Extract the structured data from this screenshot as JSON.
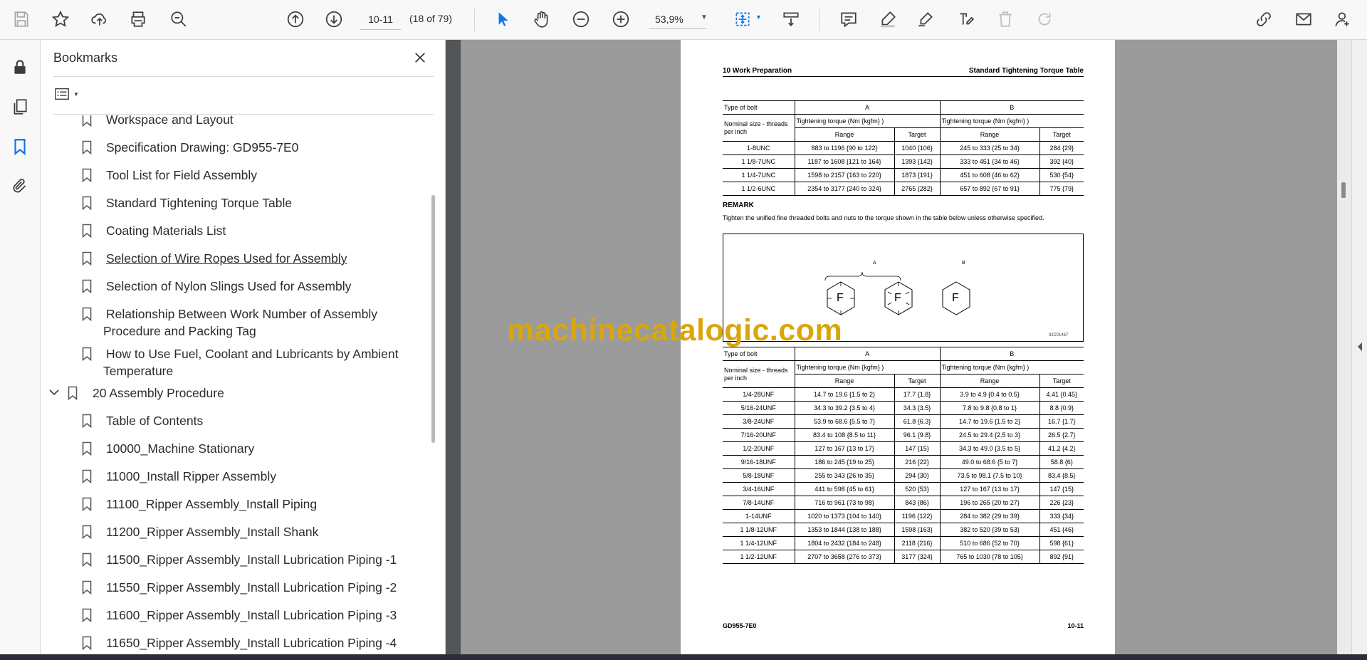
{
  "toolbar": {
    "page_value": "10-11",
    "page_count": "(18 of 79)",
    "zoom": "53,9%"
  },
  "bookmarks": {
    "title": "Bookmarks",
    "items": [
      {
        "label": "Workspace and Layout"
      },
      {
        "label": "Specification Drawing: GD955-7E0"
      },
      {
        "label": "Tool List for Field Assembly"
      },
      {
        "label": "Standard Tightening Torque Table"
      },
      {
        "label": "Coating Materials List"
      },
      {
        "label": "Selection of Wire Ropes Used for Assembly"
      },
      {
        "label": "Selection of Nylon Slings Used for Assembly"
      },
      {
        "label": "Relationship Between Work Number of Assembly Procedure and Packing Tag"
      },
      {
        "label": "How to Use Fuel, Coolant and Lubricants by Ambient Temperature"
      },
      {
        "label": "20 Assembly Procedure"
      },
      {
        "label": "Table of Contents"
      },
      {
        "label": "10000_Machine Stationary"
      },
      {
        "label": "11000_Install Ripper Assembly"
      },
      {
        "label": "11100_Ripper Assembly_Install Piping"
      },
      {
        "label": "11200_Ripper Assembly_Install Shank"
      },
      {
        "label": "11500_Ripper Assembly_Install Lubrication Piping -1"
      },
      {
        "label": "11550_Ripper Assembly_Install Lubrication Piping -2"
      },
      {
        "label": "11600_Ripper Assembly_Install Lubrication Piping -3"
      },
      {
        "label": "11650_Ripper Assembly_Install Lubrication Piping -4"
      }
    ]
  },
  "document": {
    "header_left": "10 Work Preparation",
    "header_right": "Standard Tightening Torque Table",
    "table_labels": {
      "type_of_bolt": "Type of bolt",
      "col_a": "A",
      "col_b": "B",
      "nominal": "Nominal size - threads per inch",
      "torque": "Tightening torque (Nm {kgfm} )",
      "range": "Range",
      "target": "Target"
    },
    "unc_rows": [
      [
        "1-8UNC",
        "883 to 1196 {90 to 122}",
        "1040 {106}",
        "245 to 333 {25 to 34}",
        "284 {29}"
      ],
      [
        "1 1/8-7UNC",
        "1187 to 1608 {121 to 164}",
        "1393 {142}",
        "333 to 451 {34 to 46}",
        "392 {40}"
      ],
      [
        "1 1/4-7UNC",
        "1598 to 2157 {163 to 220}",
        "1873 {191}",
        "451 to 608 {46 to 62}",
        "530 {54}"
      ],
      [
        "1 1/2-6UNC",
        "2354 to 3177 {240 to 324}",
        "2765 {282}",
        "657 to 892 {67 to 91}",
        "775 {79}"
      ]
    ],
    "remark_title": "REMARK",
    "remark_text": "Tighten the unified fine threaded bolts and nuts to the torque shown in the table below unless otherwise specified.",
    "figure": {
      "label_a": "A",
      "label_b": "B",
      "hex_letter": "F",
      "code": "9JC01467"
    },
    "unf_rows": [
      [
        "1/4-28UNF",
        "14.7 to 19.6 {1.5 to 2}",
        "17.7 {1.8}",
        "3.9 to 4.9 {0.4 to 0.5}",
        "4.41 {0.45}"
      ],
      [
        "5/16-24UNF",
        "34.3 to 39.2 {3.5 to 4}",
        "34.3 {3.5}",
        "7.8 to 9.8 {0.8 to 1}",
        "8.8 {0.9}"
      ],
      [
        "3/8-24UNF",
        "53.9 to 68.6 {5.5 to 7}",
        "61.8 {6.3}",
        "14.7 to 19.6 {1.5 to 2}",
        "16.7 {1.7}"
      ],
      [
        "7/16-20UNF",
        "83.4 to 108 {8.5 to 11}",
        "96.1 {9.8}",
        "24.5 to 29.4 {2.5 to 3}",
        "26.5 {2.7}"
      ],
      [
        "1/2-20UNF",
        "127 to 167 {13 to 17}",
        "147 {15}",
        "34.3 to 49.0 {3.5 to 5}",
        "41.2 {4.2}"
      ],
      [
        "9/16-18UNF",
        "186 to 245 {19 to 25}",
        "216 {22}",
        "49.0 to 68.6 {5 to 7}",
        "58.8 {6}"
      ],
      [
        "5/8-18UNF",
        "255 to 343 {26 to 35}",
        "294 {30}",
        "73.5 to 98.1 {7.5 to 10}",
        "83.4 {8.5}"
      ],
      [
        "3/4-16UNF",
        "441 to 598 {45 to 61}",
        "520 {53}",
        "127 to 167 {13 to 17}",
        "147 {15}"
      ],
      [
        "7/8-14UNF",
        "716 to 961 {73 to 98}",
        "843 {86}",
        "196 to 265 {20 to 27}",
        "226 {23}"
      ],
      [
        "1-14UNF",
        "1020 to 1373 {104 to 140}",
        "1196 {122}",
        "284 to 382 {29 to 39}",
        "333 {34}"
      ],
      [
        "1 1/8-12UNF",
        "1353 to 1844 {138 to 188}",
        "1598 {163}",
        "382 to 520 {39 to 53}",
        "451 {46}"
      ],
      [
        "1 1/4-12UNF",
        "1804 to 2432 {184 to 248}",
        "2118 {216}",
        "510 to 686 {52 to 70}",
        "598 {61}"
      ],
      [
        "1 1/2-12UNF",
        "2707 to 3658 {276 to 373}",
        "3177 {324}",
        "765 to 1030 {78 to 105}",
        "892 {91}"
      ]
    ],
    "footer_left": "GD955-7E0",
    "footer_right": "10-11"
  },
  "watermark": "machinecatalogic.com",
  "colors": {
    "accent": "#1473e6",
    "watermark": "#d9a60c"
  }
}
